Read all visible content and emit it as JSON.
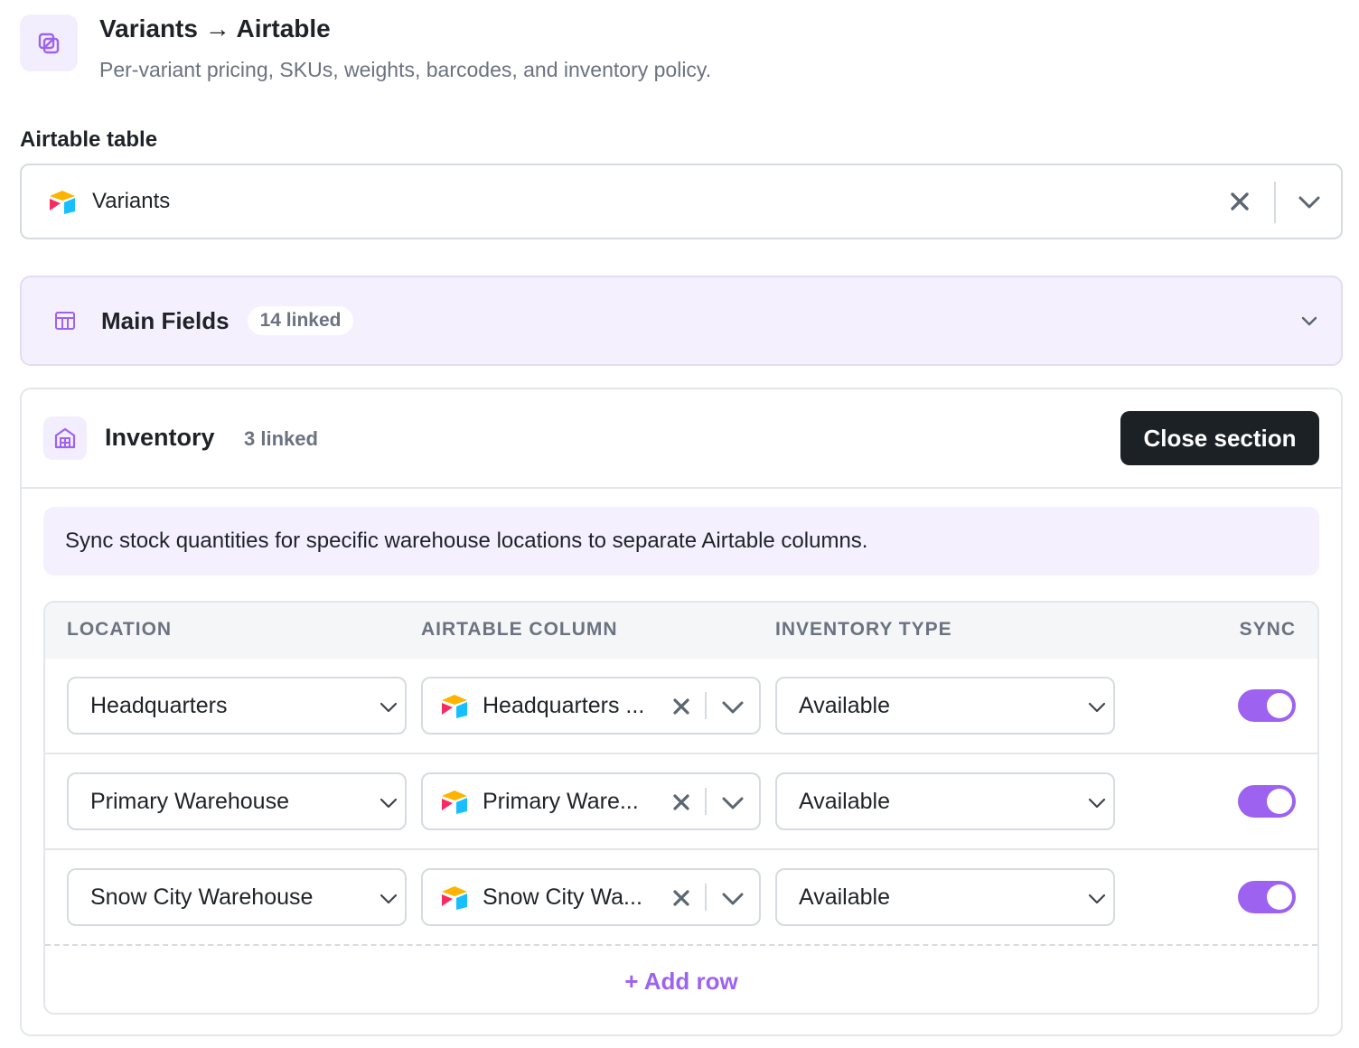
{
  "header": {
    "title": "Variants → Airtable",
    "subtitle": "Per-variant pricing, SKUs, weights, barcodes, and inventory policy."
  },
  "airtable_table": {
    "label": "Airtable table",
    "selected": "Variants"
  },
  "main_fields": {
    "title": "Main Fields",
    "linked": "14 linked"
  },
  "inventory": {
    "title": "Inventory",
    "linked": "3 linked",
    "close_label": "Close section",
    "note": "Sync stock quantities for specific warehouse locations to separate Airtable columns.",
    "columns": [
      "LOCATION",
      "AIRTABLE COLUMN",
      "INVENTORY TYPE",
      "SYNC"
    ],
    "rows": [
      {
        "location": "Headquarters",
        "column": "Headquarters ...",
        "type": "Available",
        "sync": true
      },
      {
        "location": "Primary Warehouse",
        "column": "Primary Ware...",
        "type": "Available",
        "sync": true
      },
      {
        "location": "Snow City Warehouse",
        "column": "Snow City Wa...",
        "type": "Available",
        "sync": true
      }
    ],
    "add_row_label": "+ Add row"
  },
  "colors": {
    "accent": "#9d63f0",
    "accent_bg": "#f5f0fe",
    "dark_button": "#1c2126"
  }
}
